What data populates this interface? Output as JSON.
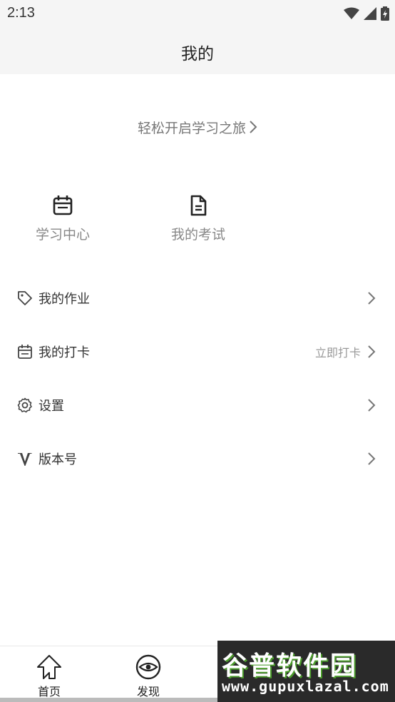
{
  "status_bar": {
    "time": "2:13",
    "icons": [
      "wifi-icon",
      "signal-icon",
      "battery-icon"
    ]
  },
  "header": {
    "title": "我的"
  },
  "banner": {
    "text": "轻松开启学习之旅"
  },
  "quick_items": [
    {
      "label": "学习中心",
      "icon": "calendar-icon"
    },
    {
      "label": "我的考试",
      "icon": "document-icon"
    }
  ],
  "menu": [
    {
      "label": "我的作业",
      "icon": "tag-icon",
      "right_text": ""
    },
    {
      "label": "我的打卡",
      "icon": "calendar-icon",
      "right_text": "立即打卡"
    },
    {
      "label": "设置",
      "icon": "gear-icon",
      "right_text": ""
    },
    {
      "label": "版本号",
      "icon": "v-icon",
      "right_text": ""
    }
  ],
  "bottom_nav": [
    {
      "label": "首页",
      "icon": "home-arrow-icon"
    },
    {
      "label": "发现",
      "icon": "eye-icon"
    }
  ],
  "watermark": {
    "title": "谷普软件园",
    "url": "www.gupuxlazal.com"
  }
}
